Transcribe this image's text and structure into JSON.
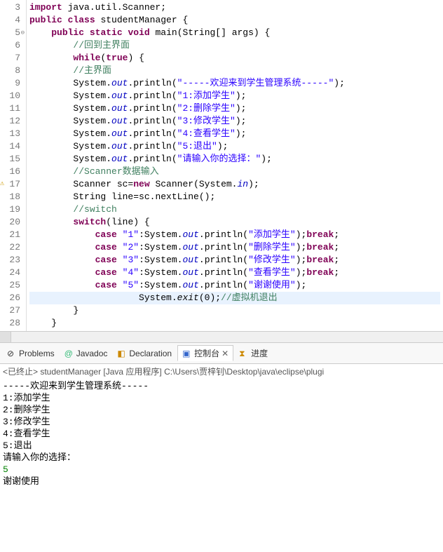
{
  "gutter": {
    "lines": [
      "3",
      "4",
      "5",
      "6",
      "7",
      "8",
      "9",
      "10",
      "11",
      "12",
      "13",
      "14",
      "15",
      "16",
      "17",
      "18",
      "19",
      "20",
      "21",
      "22",
      "23",
      "24",
      "25",
      "26",
      "27",
      "28"
    ],
    "markers": {
      "5": "fold",
      "17": "warn"
    }
  },
  "code": {
    "l3": {
      "kw1": "import",
      "t1": " java.util.Scanner;"
    },
    "l4": {
      "kw1": "public",
      "kw2": "class",
      "t1": " studentManager {"
    },
    "l5": {
      "kw1": "public",
      "kw2": "static",
      "kw3": "void",
      "t1": " main(String[] args) {"
    },
    "l6": {
      "com": "//回到主界面"
    },
    "l7": {
      "kw1": "while",
      "t1": "(",
      "kw2": "true",
      "t2": ") {"
    },
    "l8": {
      "com": "//主界面"
    },
    "l9": {
      "t1": "System.",
      "f": "out",
      "t2": ".println(",
      "s": "\"-----欢迎来到学生管理系统-----\"",
      "t3": ");"
    },
    "l10": {
      "t1": "System.",
      "f": "out",
      "t2": ".println(",
      "s": "\"1:添加学生\"",
      "t3": ");"
    },
    "l11": {
      "t1": "System.",
      "f": "out",
      "t2": ".println(",
      "s": "\"2:删除学生\"",
      "t3": ");"
    },
    "l12": {
      "t1": "System.",
      "f": "out",
      "t2": ".println(",
      "s": "\"3:修改学生\"",
      "t3": ");"
    },
    "l13": {
      "t1": "System.",
      "f": "out",
      "t2": ".println(",
      "s": "\"4:查看学生\"",
      "t3": ");"
    },
    "l14": {
      "t1": "System.",
      "f": "out",
      "t2": ".println(",
      "s": "\"5:退出\"",
      "t3": ");"
    },
    "l15": {
      "t1": "System.",
      "f": "out",
      "t2": ".println(",
      "s": "\"请输入你的选择：\"",
      "t3": ");"
    },
    "l16": {
      "com": "//Scanner数据输入"
    },
    "l17": {
      "t1": "Scanner sc=",
      "kw1": "new",
      "t2": " Scanner(System.",
      "f": "in",
      "t3": ");"
    },
    "l18": {
      "t1": "String line=sc.nextLine();"
    },
    "l19": {
      "com": "//switch"
    },
    "l20": {
      "kw1": "switch",
      "t1": "(line) {"
    },
    "l21": {
      "kw1": "case",
      "s1": "\"1\"",
      "t1": ":System.",
      "f": "out",
      "t2": ".println(",
      "s2": "\"添加学生\"",
      "t3": ");",
      "kw2": "break",
      "t4": ";"
    },
    "l22": {
      "kw1": "case",
      "s1": "\"2\"",
      "t1": ":System.",
      "f": "out",
      "t2": ".println(",
      "s2": "\"删除学生\"",
      "t3": ");",
      "kw2": "break",
      "t4": ";"
    },
    "l23": {
      "kw1": "case",
      "s1": "\"3\"",
      "t1": ":System.",
      "f": "out",
      "t2": ".println(",
      "s2": "\"修改学生\"",
      "t3": ");",
      "kw2": "break",
      "t4": ";"
    },
    "l24": {
      "kw1": "case",
      "s1": "\"4\"",
      "t1": ":System.",
      "f": "out",
      "t2": ".println(",
      "s2": "\"查看学生\"",
      "t3": ");",
      "kw2": "break",
      "t4": ";"
    },
    "l25": {
      "kw1": "case",
      "s1": "\"5\"",
      "t1": ":System.",
      "f": "out",
      "t2": ".println(",
      "s2": "\"谢谢使用\"",
      "t3": ");"
    },
    "l26": {
      "t1": "System.",
      "m": "exit",
      "t2": "(0);",
      "com": "//虚拟机退出"
    },
    "l27": {
      "t1": "}"
    },
    "l28": {
      "t1": "}"
    }
  },
  "tabs": {
    "problems": "Problems",
    "javadoc": "Javadoc",
    "declaration": "Declaration",
    "console": "控制台",
    "progress": "进度"
  },
  "console": {
    "header": "<已终止> studentManager [Java 应用程序] C:\\Users\\贾梓钊\\Desktop\\java\\eclipse\\plugi",
    "lines": [
      "-----欢迎来到学生管理系统-----",
      "1:添加学生",
      "2:删除学生",
      "3:修改学生",
      "4:查看学生",
      "5:退出",
      "请输入你的选择：",
      "5",
      "谢谢使用"
    ],
    "input_line_index": 7
  }
}
